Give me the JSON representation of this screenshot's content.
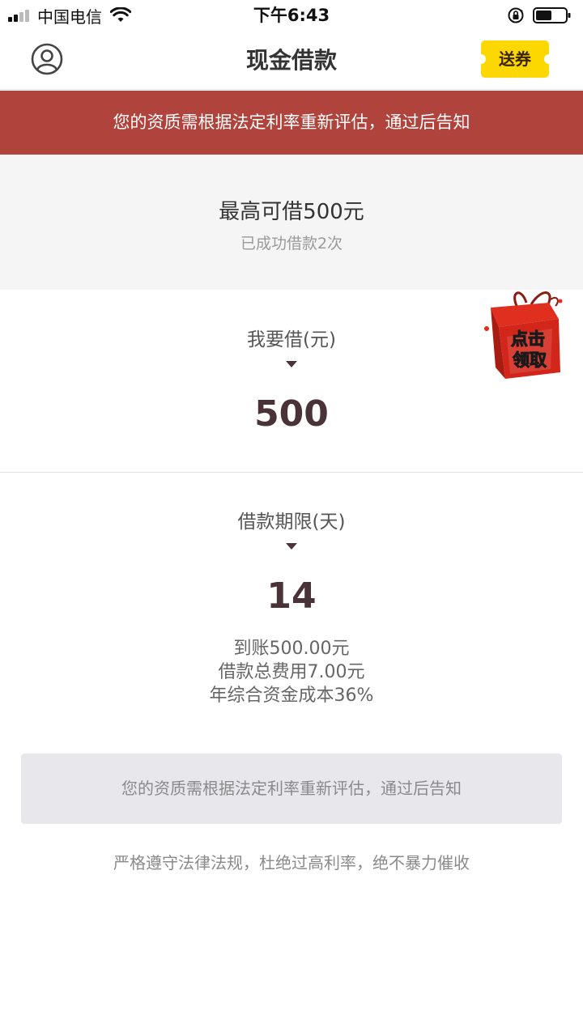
{
  "status_bar": {
    "carrier": "中国电信",
    "time": "下午6:43",
    "icons": [
      "signal-icon",
      "wifi-icon",
      "orientation-lock-icon",
      "battery-icon"
    ]
  },
  "nav": {
    "title": "现金借款",
    "coupon_label": "送券",
    "avatar_icon": "user-avatar-icon",
    "coupon_color": "#fdd800"
  },
  "alert": {
    "text": "您的资质需根据法定利率重新评估，通过后告知",
    "color": "#b0433b"
  },
  "quota": {
    "max_text": "最高可借500元",
    "history_text": "已成功借款2次"
  },
  "gift_badge": {
    "text_line1": "点击",
    "text_line2": "领取",
    "icon": "gift-box-icon"
  },
  "amount": {
    "label": "我要借(元)",
    "value": "500"
  },
  "term": {
    "label": "借款期限(天)",
    "value": "14"
  },
  "details": {
    "received": "到账500.00元",
    "total_fee": "借款总费用7.00元",
    "annual_cost": "年综合资金成本36%"
  },
  "submit": {
    "label": "您的资质需根据法定利率重新评估，通过后告知"
  },
  "footer": {
    "note": "严格遵守法律法规，杜绝过高利率，绝不暴力催收"
  }
}
